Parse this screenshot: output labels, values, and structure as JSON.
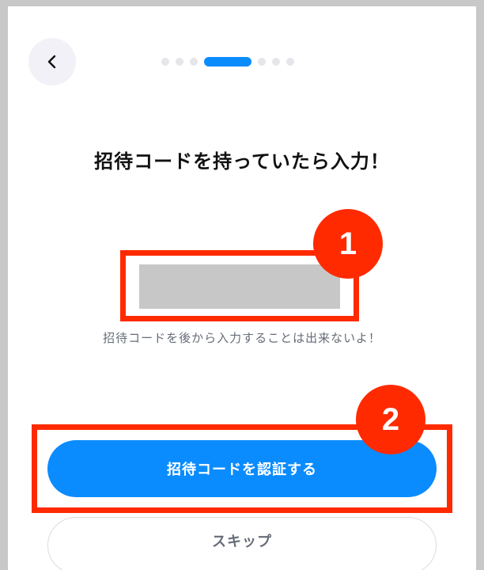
{
  "header": {
    "back_icon": "chevron-left-icon",
    "progress": {
      "total_steps": 8,
      "current_step": 4
    }
  },
  "title": "招待コードを持っていたら入力！",
  "code_input": {
    "value": "",
    "placeholder": ""
  },
  "hint": "招待コードを後から入力することは出来ないよ！",
  "annotations": [
    {
      "label": "1"
    },
    {
      "label": "2"
    }
  ],
  "actions": {
    "verify_label": "招待コードを認証する",
    "skip_label": "スキップ"
  },
  "colors": {
    "accent": "#0a8cff",
    "annotation": "#ff2a00",
    "input_fill": "#c7c7c7",
    "muted_text": "#666d78"
  }
}
